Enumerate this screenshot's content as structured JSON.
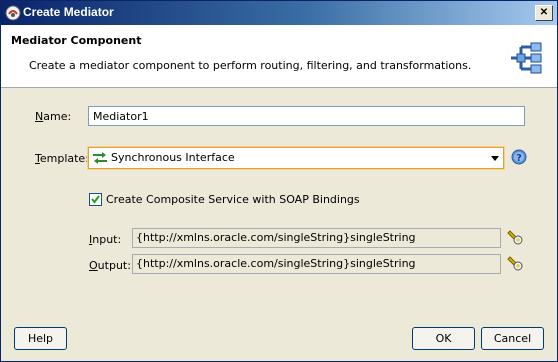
{
  "window": {
    "title": "Create Mediator"
  },
  "header": {
    "title": "Mediator Component",
    "description": "Create a mediator component to perform routing, filtering, and transformations."
  },
  "form": {
    "name": {
      "label_first": "N",
      "label_rest": "ame:",
      "value": "Mediator1"
    },
    "template": {
      "label_first": "T",
      "label_rest": "emplate:",
      "value": "Synchronous Interface"
    },
    "composite_checkbox": {
      "label": "Create Composite Service with SOAP Bindings",
      "checked": true
    },
    "input": {
      "label_first": "I",
      "label_rest": "nput:",
      "value": "{http://xmlns.oracle.com/singleString}singleString"
    },
    "output": {
      "label_first": "O",
      "label_rest": "utput:",
      "value": "{http://xmlns.oracle.com/singleString}singleString"
    }
  },
  "buttons": {
    "help": "Help",
    "ok": "OK",
    "cancel": "Cancel"
  },
  "icons": {
    "title": "mediator-app-icon",
    "header": "mediator-component-icon",
    "template": "synchronous-interface-icon",
    "help": "help-icon",
    "picker": "flashlight-browse-icon"
  },
  "colors": {
    "title_bar": "#0a246a",
    "focus_border": "#e3a233",
    "dialog_bg": "#ece9d8"
  }
}
